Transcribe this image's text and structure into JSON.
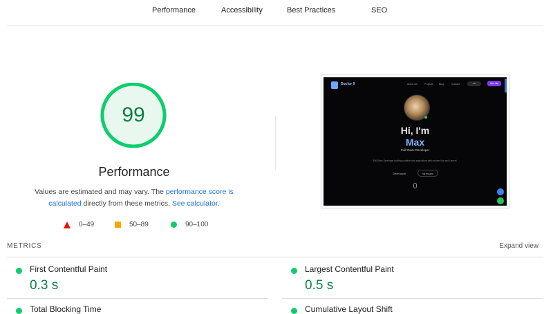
{
  "nav": {
    "tabs": [
      {
        "label": "Performance"
      },
      {
        "label": "Accessibility"
      },
      {
        "label": "Best Practices"
      },
      {
        "label": "SEO"
      }
    ]
  },
  "score": {
    "value": "99",
    "score_fraction": 0.99,
    "title": "Performance",
    "pass_color": "#0cce6b",
    "pass_text_color": "#0b8043"
  },
  "description": {
    "text_before": "Values are estimated and may vary. The ",
    "link_score": "performance score is calculated",
    "text_middle": " directly from these metrics. ",
    "link_calculator": "See calculator."
  },
  "legend": [
    {
      "range": "0–49",
      "shape": "triangle",
      "color": "#eb0f00"
    },
    {
      "range": "50–89",
      "shape": "square",
      "color": "#ffa400"
    },
    {
      "range": "90–100",
      "shape": "circle",
      "color": "#0cce6b"
    }
  ],
  "screenshot": {
    "brand": "Doctor 9",
    "nav_items": [
      "About me",
      "Projects",
      "Blog",
      "Contact"
    ],
    "pill": "EN",
    "cta": "Hire Me",
    "greeting": "Hi, I'm",
    "name": "Max",
    "role": "Full Stack Developer",
    "blurb": "Full-Stack Developer building scalable web applications with modern Vue and Laravel.",
    "button_primary": "Get in touch",
    "button_secondary": "My resume"
  },
  "metrics": {
    "label": "METRICS",
    "expand_label": "Expand view",
    "items": [
      {
        "name": "First Contentful Paint",
        "value": "0.3 s"
      },
      {
        "name": "Largest Contentful Paint",
        "value": "0.5 s"
      },
      {
        "name": "Total Blocking Time",
        "value": ""
      },
      {
        "name": "Cumulative Layout Shift",
        "value": ""
      }
    ]
  }
}
